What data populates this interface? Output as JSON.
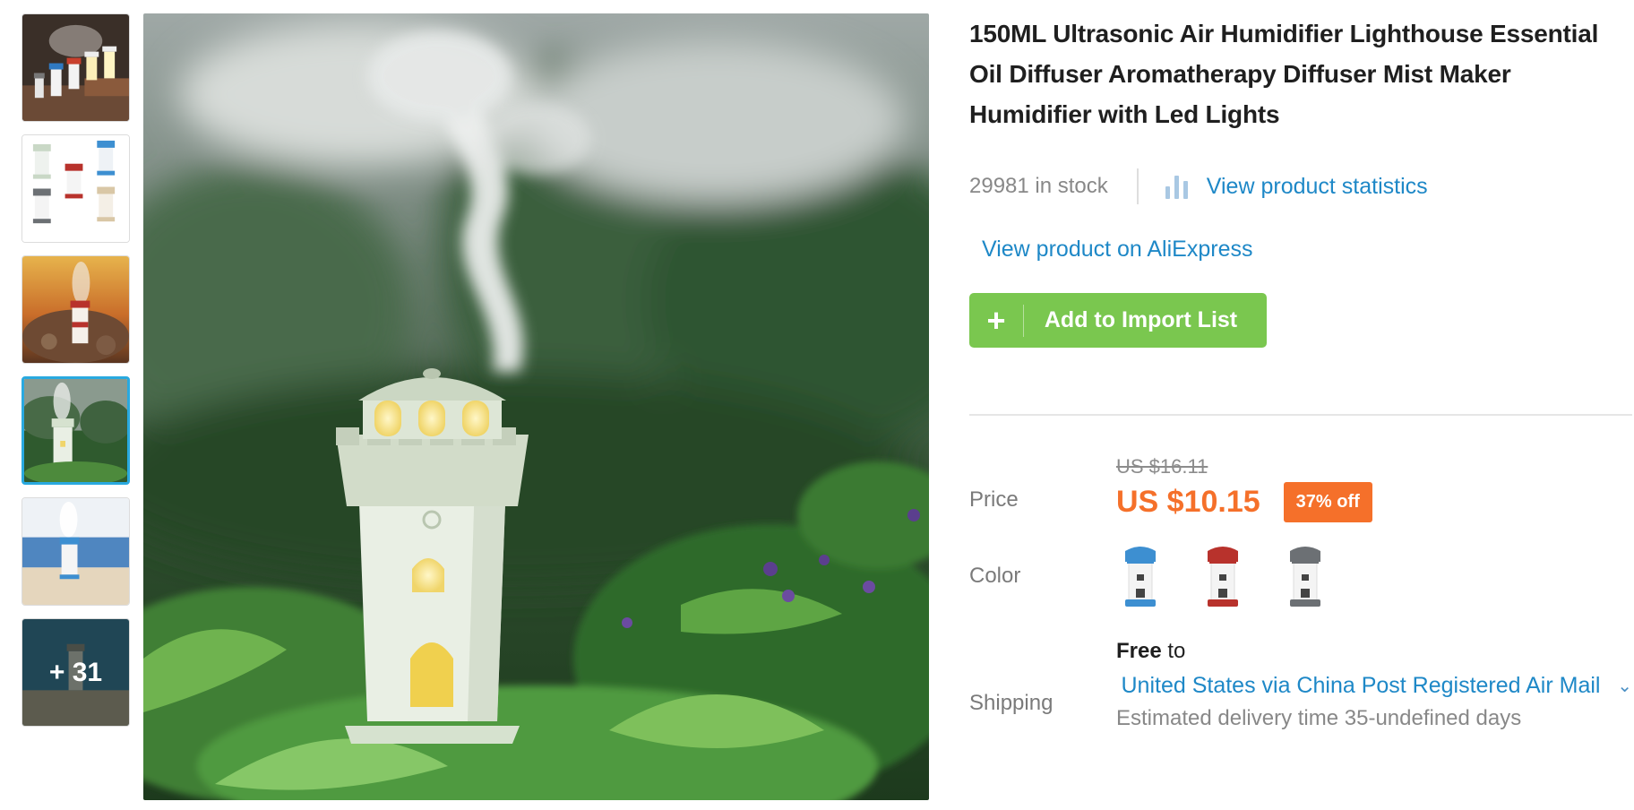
{
  "thumbnails": {
    "items": [
      {
        "name": "thumb-lighthouses-on-books",
        "scene": "books"
      },
      {
        "name": "thumb-color-variants",
        "scene": "variants"
      },
      {
        "name": "thumb-sunset-rocks",
        "scene": "sunset"
      },
      {
        "name": "thumb-green-garden",
        "scene": "garden"
      },
      {
        "name": "thumb-beach",
        "scene": "beach"
      },
      {
        "name": "thumb-more",
        "scene": "more"
      }
    ],
    "active_index": 3,
    "more_label": "+ 31"
  },
  "product": {
    "title": "150ML Ultrasonic Air Humidifier Lighthouse Essential Oil Diffuser Aromatherapy Diffuser Mist Maker Humidifier with Led Lights",
    "stock_text": "29981 in stock",
    "stats_link": "View product statistics",
    "ali_link": "View product on AliExpress",
    "add_button": "Add to Import List",
    "add_icon": "+"
  },
  "price": {
    "label": "Price",
    "original": "US $16.11",
    "current": "US $10.15",
    "discount": "37% off"
  },
  "color": {
    "label": "Color",
    "options": [
      {
        "name": "blue",
        "roof": "#3d8fd1",
        "body": "#f4f4f4",
        "base": "#3d8fd1"
      },
      {
        "name": "red",
        "roof": "#b8322c",
        "body": "#f4f4f4",
        "base": "#b8322c"
      },
      {
        "name": "gray",
        "roof": "#6c7074",
        "body": "#f4f4f4",
        "base": "#6c7074"
      }
    ]
  },
  "shipping": {
    "label": "Shipping",
    "free_word": "Free",
    "to_word": " to",
    "method": "United States via China Post Registered Air Mail",
    "eta": "Estimated delivery time 35-undefined days"
  },
  "colors": {
    "link": "#1e88c7",
    "accent_orange": "#f5702a",
    "button_green": "#7ac74f",
    "active_thumb_border": "#29a9df"
  }
}
